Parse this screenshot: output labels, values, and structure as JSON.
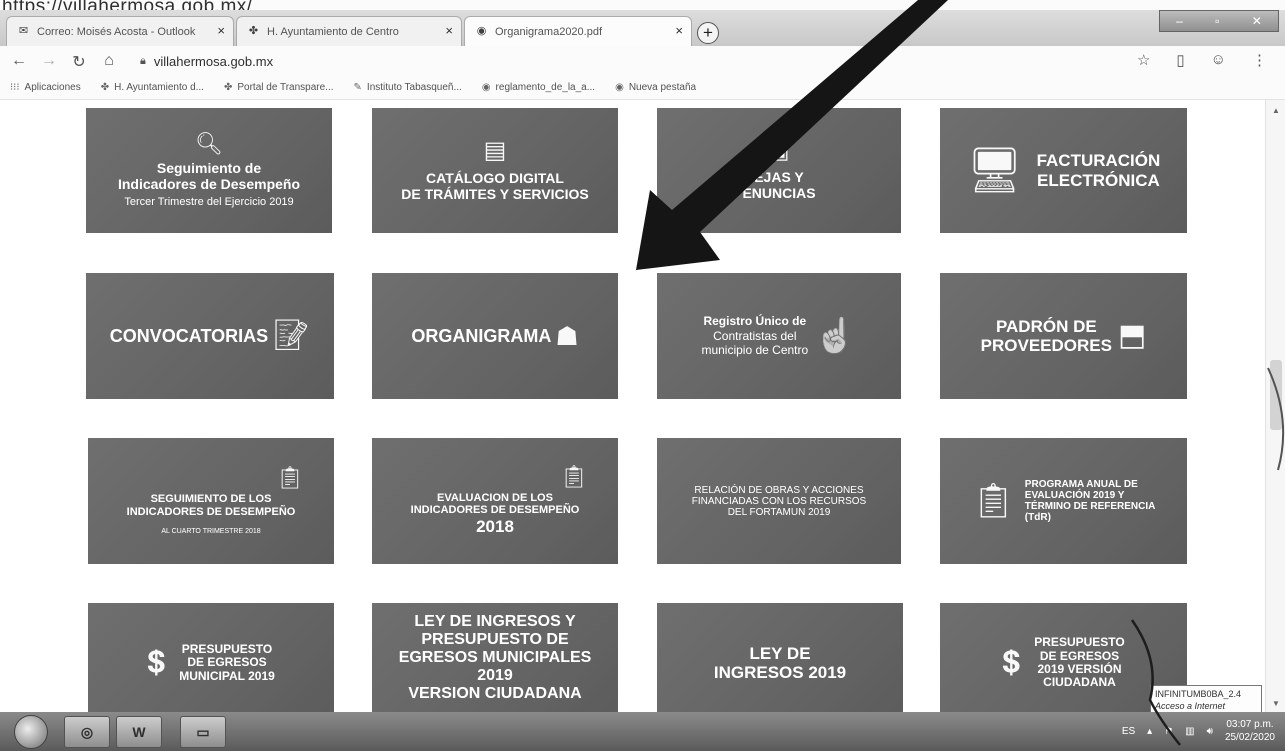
{
  "top_url": "https://villahermosa.gob.mx/",
  "tabs": [
    {
      "title": "Correo: Moisés Acosta - Outlook",
      "icon": "outlook-icon"
    },
    {
      "title": "H. Ayuntamiento de Centro",
      "icon": "municipal-icon"
    },
    {
      "title": "Organigrama2020.pdf",
      "icon": "globe-icon"
    }
  ],
  "address": {
    "url": "villahermosa.gob.mx"
  },
  "bookmarks": [
    {
      "label": "Aplicaciones",
      "icon": "apps-grid-icon"
    },
    {
      "label": "H. Ayuntamiento d...",
      "icon": "municipal-icon"
    },
    {
      "label": "Portal de Transpare...",
      "icon": "municipal-icon"
    },
    {
      "label": "Instituto Tabasqueñ...",
      "icon": "feather-icon"
    },
    {
      "label": "reglamento_de_la_a...",
      "icon": "globe-icon"
    },
    {
      "label": "Nueva pestaña",
      "icon": "globe-icon"
    }
  ],
  "tiles": [
    {
      "lines": [
        "Seguimiento de",
        "Indicadores de Desempeño"
      ],
      "sub": "Tercer Trimestre del Ejercicio 2019",
      "icon": "magnifier-chart-icon"
    },
    {
      "lines": [
        "CATÁLOGO DIGITAL",
        "DE TRÁMITES Y SERVICIOS"
      ],
      "sub": "",
      "icon": "catalog-icon"
    },
    {
      "lines": [
        "EJAS Y",
        "ENUNCIAS"
      ],
      "sub": "",
      "icon": "complaint-icon"
    },
    {
      "lines": [
        "FACTURACIÓN",
        "ELECTRÓNICA"
      ],
      "sub": "",
      "icon": "computer-icon"
    },
    {
      "lines": [
        "CONVOCATORIAS"
      ],
      "sub": "",
      "icon": "document-pen-icon"
    },
    {
      "lines": [
        "ORGANIGRAMA"
      ],
      "sub": "",
      "icon": "org-chart-icon"
    },
    {
      "lines": [
        "Registro Único de",
        "Contratistas del",
        "municipio de Centro"
      ],
      "sub": "",
      "icon": "hand-pointer-icon"
    },
    {
      "lines": [
        "PADRÓN DE",
        "PROVEEDORES"
      ],
      "sub": "",
      "icon": "box-hand-icon"
    },
    {
      "lines": [
        "SEGUIMIENTO DE LOS",
        "INDICADORES DE DESEMPEÑO"
      ],
      "sub": "AL CUARTO TRIMESTRE 2018",
      "icon": "clipboard-gear-icon"
    },
    {
      "lines": [
        "EVALUACION DE LOS",
        "INDICADORES DE DESEMPEÑO",
        "2018"
      ],
      "sub": "",
      "icon": "clipboard-gear-icon"
    },
    {
      "lines": [
        "RELACIÓN DE OBRAS Y ACCIONES",
        "FINANCIADAS CON LOS RECURSOS",
        "DEL FORTAMUN 2019"
      ],
      "sub": "",
      "icon": ""
    },
    {
      "lines": [
        "PROGRAMA ANUAL DE",
        "EVALUACIÓN 2019 Y",
        "TÉRMINO DE REFERENCIA",
        "(TdR)"
      ],
      "sub": "",
      "icon": "clipboard-check-icon"
    },
    {
      "lines": [
        "PRESUPUESTO",
        "DE EGRESOS",
        "MUNICIPAL 2019"
      ],
      "sub": "",
      "icon": "money-hand-icon"
    },
    {
      "lines": [
        "LEY DE INGRESOS Y",
        "PRESUPUESTO DE",
        "EGRESOS MUNICIPALES",
        "2019",
        "VERSION CIUDADANA"
      ],
      "sub": "",
      "icon": ""
    },
    {
      "lines": [
        "LEY DE",
        "INGRESOS 2019"
      ],
      "sub": "",
      "icon": ""
    },
    {
      "lines": [
        "PRESUPUESTO",
        "DE EGRESOS",
        "2019 VERSIÓN",
        "CIUDADANA"
      ],
      "sub": "",
      "icon": "money-hand-icon"
    }
  ],
  "tooltip": {
    "line1": "INFINITUMB0BA_2.4",
    "line2": "Acceso a Internet"
  },
  "taskbar": {
    "language": "ES",
    "time": "03:07 p.m.",
    "date": "25/02/2020"
  }
}
